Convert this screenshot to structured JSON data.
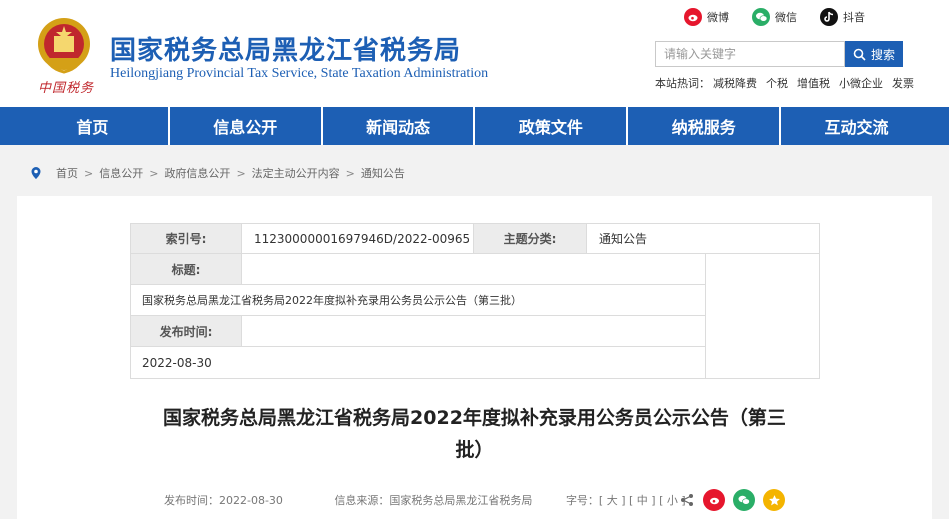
{
  "header": {
    "brand_script": "中国税务",
    "title": "国家税务总局黑龙江省税务局",
    "subtitle": "Heilongjiang Provincial Tax Service, State Taxation Administration",
    "social": [
      {
        "label": "微博",
        "icon": "weibo-icon",
        "color": "#e6162d"
      },
      {
        "label": "微信",
        "icon": "wechat-icon",
        "color": "#2aae67"
      },
      {
        "label": "抖音",
        "icon": "douyin-icon",
        "color": "#111111"
      }
    ],
    "search": {
      "placeholder": "请输入关键字",
      "button_label": "搜索"
    },
    "hot_prefix": "本站热词：",
    "hot_links": [
      "减税降费",
      "个税",
      "增值税",
      "小微企业",
      "发票"
    ]
  },
  "nav": {
    "items": [
      "首页",
      "信息公开",
      "新闻动态",
      "政策文件",
      "纳税服务",
      "互动交流"
    ]
  },
  "breadcrumb": [
    "首页",
    "信息公开",
    "政府信息公开",
    "法定主动公开内容",
    "通知公告"
  ],
  "meta": {
    "index_label": "索引号:",
    "index_value": "11230000001697946D/2022-00965",
    "category_label": "主题分类:",
    "category_value": "通知公告",
    "title_label": "标题:",
    "title_value": "国家税务总局黑龙江省税务局2022年度拟补充录用公务员公示公告（第三批）",
    "date_label": "发布时间:",
    "date_value": "2022-08-30"
  },
  "article": {
    "title_line1": "国家税务总局黑龙江省税务局2022年度拟补充录用公务员公示公告（第三",
    "title_line2": "批）",
    "publish": "发布时间：2022-08-30",
    "source": "信息来源：国家税务总局黑龙江省税务局",
    "font_size_label": "字号：[ 大 ] [ 中 ] [ 小 ]"
  },
  "colors": {
    "brand_blue": "#1d5fb4",
    "weibo_red": "#e6162d",
    "wechat_green": "#2aae67",
    "collect_yellow": "#f4b400"
  }
}
